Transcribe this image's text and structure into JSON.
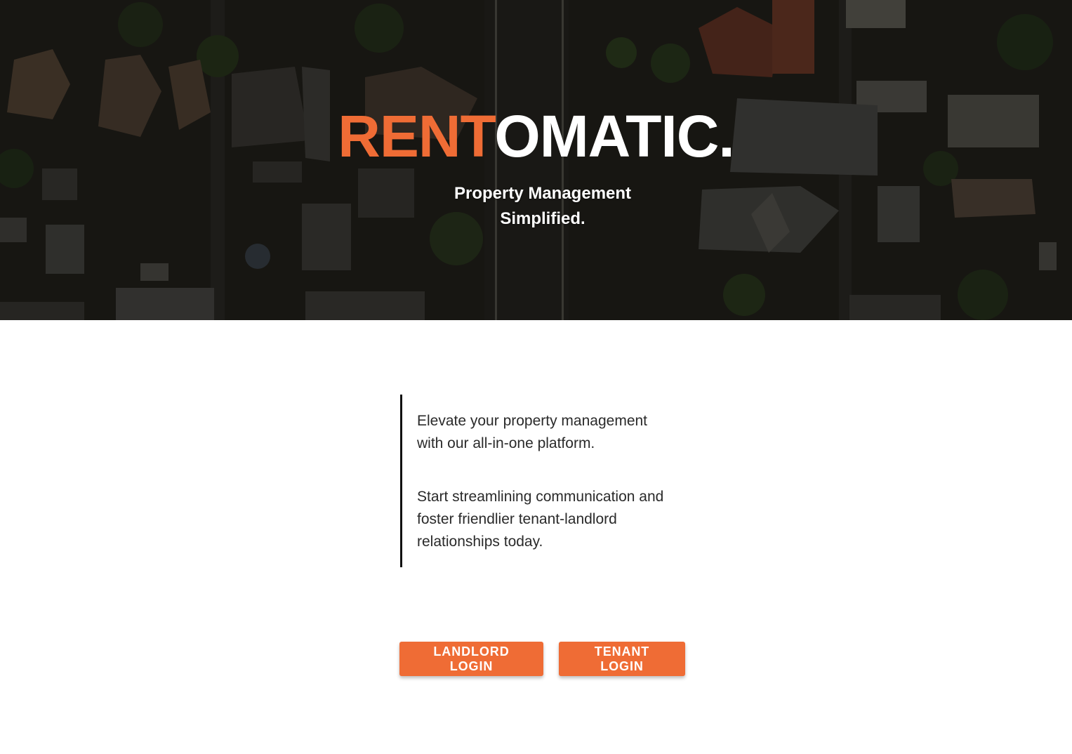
{
  "hero": {
    "logo_accent": "RENT",
    "logo_rest": "OMATIC.",
    "tagline": "Property Management Simplified.",
    "background": "aerial-neighborhood-rooftops-photo"
  },
  "intro": {
    "paragraph_1": "Elevate your property management with our all-in-one platform.",
    "paragraph_2": "Start streamlining communication and foster friendlier tenant-landlord relationships today."
  },
  "actions": {
    "landlord_login_label": "LANDLORD LOGIN",
    "tenant_login_label": "TENANT LOGIN"
  },
  "colors": {
    "accent": "#ef6c35",
    "text": "#2a2a2a",
    "quote_bar": "#111111"
  }
}
